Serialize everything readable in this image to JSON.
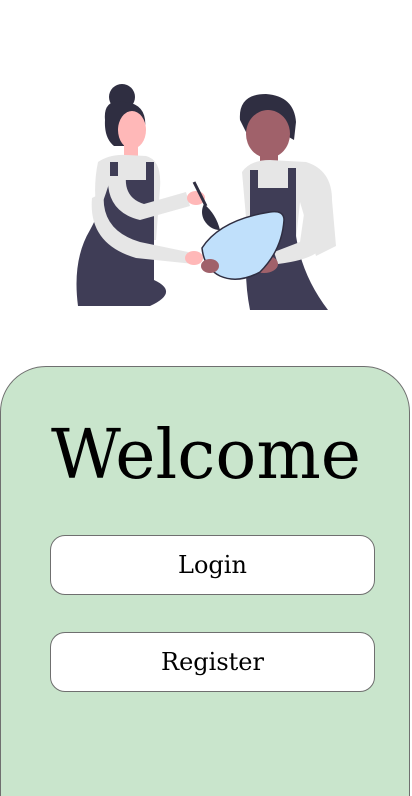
{
  "hero": {
    "illustration_icon": "two-cooks-mixing-bowl-illustration"
  },
  "auth": {
    "title": "Welcome",
    "login_label": "Login",
    "register_label": "Register"
  },
  "colors": {
    "card_background": "#c9e5cc",
    "card_border": "#6f6f6f",
    "button_background": "#ffffff",
    "apron": "#3f3d56",
    "shirt": "#e6e6e6",
    "skin_light": "#ffb8b8",
    "skin_dark": "#a0616a",
    "hair": "#2f2e41",
    "bowl": "#c0e0fb"
  }
}
